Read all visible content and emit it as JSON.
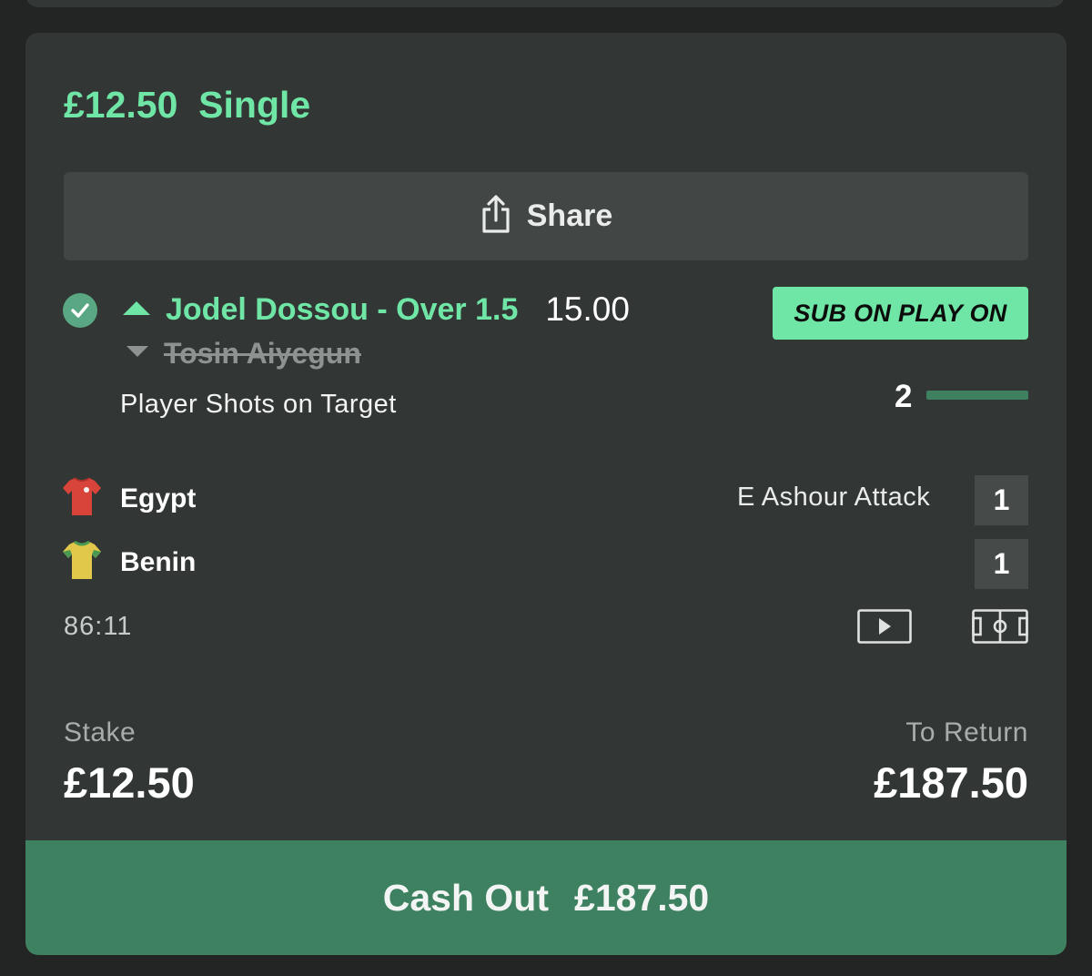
{
  "bet": {
    "title": "£12.50  Single",
    "share_label": "Share",
    "selection": {
      "name": "Jodel Dossou - Over 1.5",
      "odds": "15.00",
      "substituted_player": "Tosin Aiyegun",
      "market": "Player Shots on Target",
      "badge": "SUB ON PLAY ON",
      "progress_value": "2",
      "progress_fraction": 1.0
    },
    "match": {
      "home_team": "Egypt",
      "home_score": "1",
      "home_event": "E Ashour Attack",
      "away_team": "Benin",
      "away_score": "1",
      "clock": "86:11"
    },
    "stake_label": "Stake",
    "stake_value": "£12.50",
    "return_label": "To Return",
    "return_value": "£187.50",
    "cashout_label": "Cash Out",
    "cashout_value": "£187.50"
  },
  "colors": {
    "accent": "#6fe6a6",
    "cashout": "#3e8160",
    "card": "#323634",
    "background": "#222523"
  },
  "icons": {
    "share": "share-icon",
    "check": "check-icon",
    "up": "chevron-up-icon",
    "down": "chevron-down-icon",
    "egypt_shirt": "red-shirt-icon",
    "benin_shirt": "yellow-shirt-icon",
    "video": "play-video-icon",
    "pitch": "pitch-icon"
  }
}
